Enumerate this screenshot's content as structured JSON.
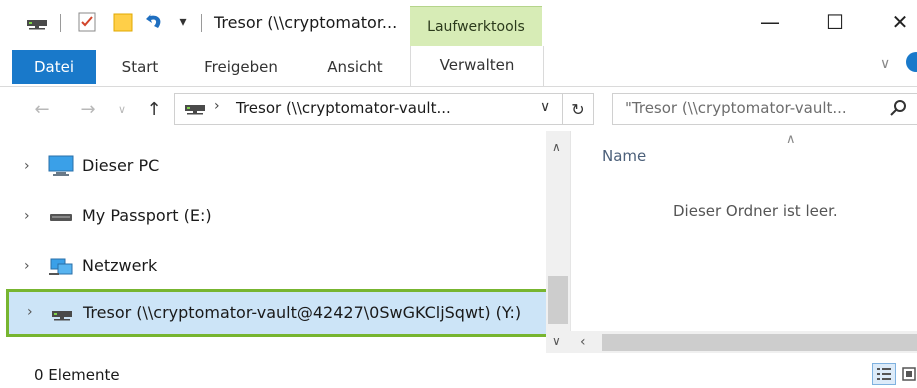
{
  "window": {
    "title": "Tresor (\\\\cryptomator...",
    "context_tab": "Laufwerktools",
    "controls": {
      "minimize": "—",
      "maximize": "☐",
      "close": "✕"
    }
  },
  "quick_access": {
    "dropdown_glyph": "▾"
  },
  "ribbon": {
    "tabs": [
      "Datei",
      "Start",
      "Freigeben",
      "Ansicht",
      "Verwalten"
    ],
    "collapse_glyph": "∨"
  },
  "address_bar": {
    "path": "Tresor (\\\\cryptomator-vault...",
    "dropdown_glyph": "∨",
    "refresh_glyph": "↻"
  },
  "search": {
    "placeholder": "\"Tresor (\\\\cryptomator-vault...",
    "icon": "search-icon"
  },
  "nav_pane": {
    "items": [
      {
        "label": "Dieser PC",
        "icon": "computer-icon"
      },
      {
        "label": "My Passport (E:)",
        "icon": "drive-icon"
      },
      {
        "label": "Netzwerk",
        "icon": "network-icon"
      },
      {
        "label": "Tresor (\\\\cryptomator-vault@42427\\0SwGKCljSqwt) (Y:)",
        "icon": "network-drive-icon",
        "selected": true
      }
    ]
  },
  "content": {
    "column_header": "Name",
    "empty_message": "Dieser Ordner ist leer."
  },
  "status_bar": {
    "item_count": "0 Elemente"
  },
  "colors": {
    "accent_blue": "#1979ca",
    "context_green": "#d7ecb6",
    "highlight_border": "#77b530",
    "selection": "#cce4f7"
  }
}
